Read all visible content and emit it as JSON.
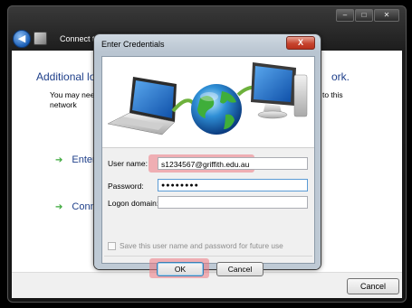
{
  "background_window": {
    "title": "Connect to a network",
    "back_button_label": "",
    "heading": "Additional lo",
    "heading_end": "ork.",
    "description_line1": "You may nee",
    "description_line2": "network",
    "description_end": "ct to this",
    "options": [
      {
        "label": "Enter",
        "icon": "green-arrow-icon"
      },
      {
        "label": "Conn",
        "icon": "green-arrow-icon"
      }
    ],
    "cancel_label": "Cancel",
    "window_controls": {
      "minimize": "–",
      "maximize": "□",
      "close": "✕"
    }
  },
  "dialog": {
    "title": "Enter Credentials",
    "close_glyph": "X",
    "fields": {
      "user_name": {
        "label": "User name:",
        "value": "s1234567@griffith.edu.au"
      },
      "password": {
        "label": "Password:",
        "value": "●●●●●●●●"
      },
      "logon_domain": {
        "label": "Logon domain:",
        "value": ""
      }
    },
    "save_checkbox": {
      "label": "Save this user name and password for future use",
      "checked": false,
      "enabled": false
    },
    "buttons": {
      "ok": "OK",
      "cancel": "Cancel"
    }
  },
  "colors": {
    "highlight": "#ee7882",
    "link_blue": "#1e3f8a",
    "arrow_green": "#3aa839"
  }
}
